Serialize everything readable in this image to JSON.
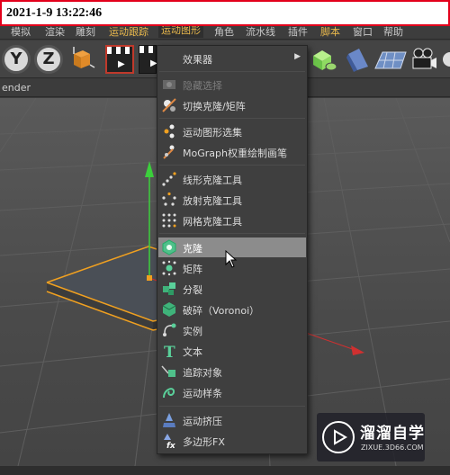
{
  "timestamp": "2021-1-9 13:22:46",
  "menubar": [
    {
      "label": "模拟"
    },
    {
      "label": "渲染"
    },
    {
      "label": "雕刻"
    },
    {
      "label": "运动跟踪"
    },
    {
      "label": "运动图形"
    },
    {
      "label": "角色"
    },
    {
      "label": "流水线"
    },
    {
      "label": "插件"
    },
    {
      "label": "脚本"
    },
    {
      "label": "窗口"
    },
    {
      "label": "帮助"
    }
  ],
  "toolbar": {
    "axis_y": "Y",
    "axis_z": "Z"
  },
  "viewport": {
    "label": "ender"
  },
  "menu": {
    "effectors": "效果器",
    "hide_selection": "隐藏选择",
    "toggle_clone_matrix": "切换克隆/矩阵",
    "mograph_selection": "运动图形选集",
    "weight_paint": "MoGraph权重绘制画笔",
    "linear_clone_tool": "线形克隆工具",
    "radial_clone_tool": "放射克隆工具",
    "grid_clone_tool": "网格克隆工具",
    "cloner": "克隆",
    "matrix": "矩阵",
    "fracture": "分裂",
    "voronoi": "破碎（Voronoi）",
    "instance": "实例",
    "text": "文本",
    "tracer": "追踪对象",
    "spline": "运动样条",
    "extrude": "运动挤压",
    "poly_fx": "多边形FX"
  },
  "watermark": {
    "title": "溜溜自学",
    "url": "ZIXUE.3D66.COM"
  },
  "colors": {
    "accent_menu": "#e9b84c",
    "highlight_row": "#8c8c8c",
    "stamp_border": "#e3001b"
  }
}
